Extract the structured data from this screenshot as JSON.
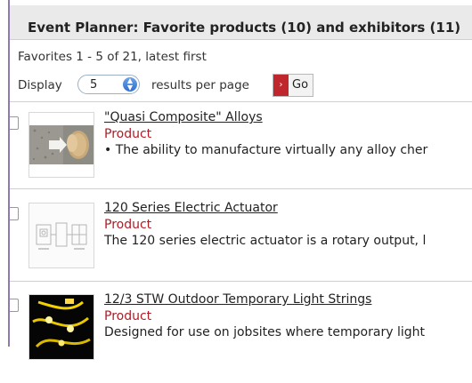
{
  "header": {
    "title": "Event Planner: Favorite products (10) and exhibitors (11)"
  },
  "summary": "Favorites 1 - 5 of 21, latest first",
  "display": {
    "label": "Display",
    "selected": "5",
    "per_page": "results per page",
    "go_label": "Go",
    "go_arrow": "›",
    "arrows_glyph": "▲▼"
  },
  "items": [
    {
      "title": "\"Quasi Composite\" Alloys",
      "type": "Product",
      "desc": "• The ability to manufacture virtually any alloy cher"
    },
    {
      "title": "120 Series Electric Actuator",
      "type": "Product",
      "desc": "The 120 series electric actuator is a rotary output, l"
    },
    {
      "title": "12/3 STW Outdoor Temporary Light Strings",
      "type": "Product",
      "desc": "Designed for use on jobsites where temporary light"
    }
  ],
  "colors": {
    "accent": "#b01b25",
    "header_bg": "#eaeaea",
    "frame": "#8e7ab0"
  }
}
